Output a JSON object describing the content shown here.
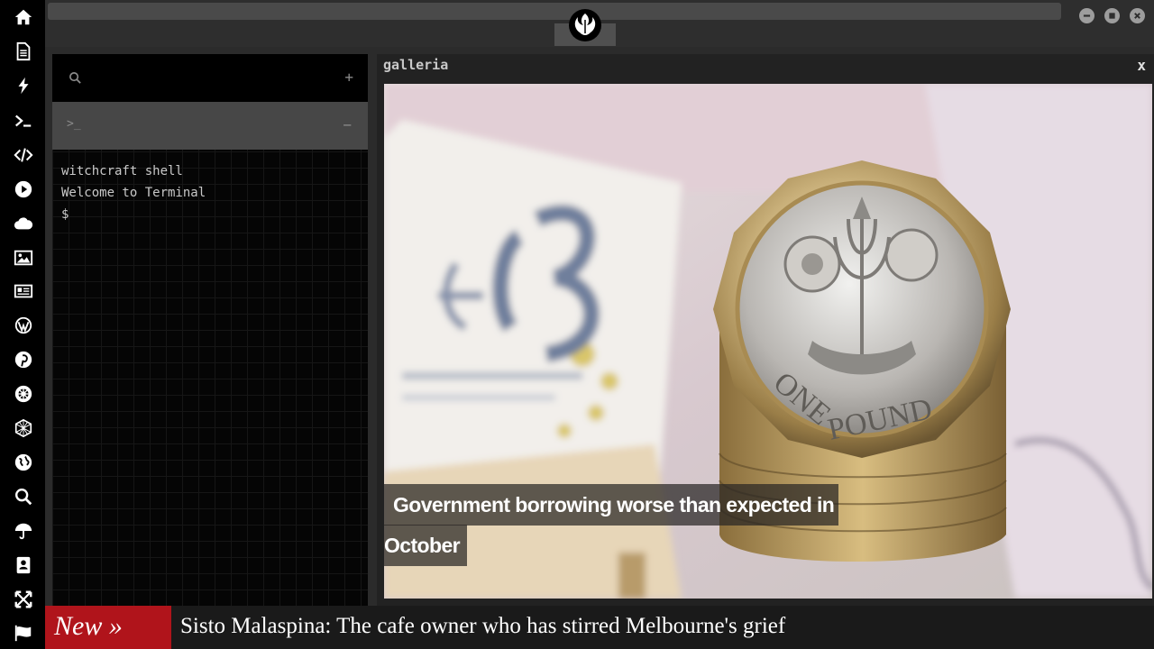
{
  "window": {
    "controls": [
      "minimize",
      "maximize",
      "close"
    ]
  },
  "sidebar": {
    "items": [
      {
        "name": "home",
        "icon": "home-icon"
      },
      {
        "name": "document",
        "icon": "document-icon"
      },
      {
        "name": "lightning",
        "icon": "lightning-icon"
      },
      {
        "name": "terminal",
        "icon": "terminal-icon"
      },
      {
        "name": "code",
        "icon": "code-icon"
      },
      {
        "name": "play",
        "icon": "play-icon"
      },
      {
        "name": "cloud",
        "icon": "cloud-icon"
      },
      {
        "name": "image",
        "icon": "image-icon"
      },
      {
        "name": "news",
        "icon": "newspaper-icon"
      },
      {
        "name": "wordpress",
        "icon": "wordpress-icon"
      },
      {
        "name": "pinterest",
        "icon": "pinterest-icon"
      },
      {
        "name": "settings",
        "icon": "gear-icon"
      },
      {
        "name": "network",
        "icon": "network-icon"
      },
      {
        "name": "globe",
        "icon": "globe-icon"
      },
      {
        "name": "search",
        "icon": "search-icon"
      },
      {
        "name": "weather",
        "icon": "umbrella-icon"
      },
      {
        "name": "contacts",
        "icon": "contacts-icon"
      },
      {
        "name": "fullscreen",
        "icon": "expand-icon"
      },
      {
        "name": "flag",
        "icon": "flag-icon"
      }
    ]
  },
  "terminal": {
    "search_glyph": "search-icon",
    "add_label": "+",
    "tab_prompt": ">_",
    "collapse_label": "−",
    "lines": {
      "title": "witchcraft shell",
      "welcome": "Welcome to Terminal",
      "prompt": "$"
    }
  },
  "gallery": {
    "title": "galleria",
    "close_label": "x",
    "headline_line1": "Government borrowing worse than expected in",
    "headline_line2": "October"
  },
  "ticker": {
    "label": "New »",
    "text": "Sisto Malaspina: The cafe owner who has stirred Melbourne's grief"
  },
  "colors": {
    "ticker_label_bg": "#b0141b",
    "sidebar_bg": "#000000",
    "panel_bg": "#222222"
  }
}
